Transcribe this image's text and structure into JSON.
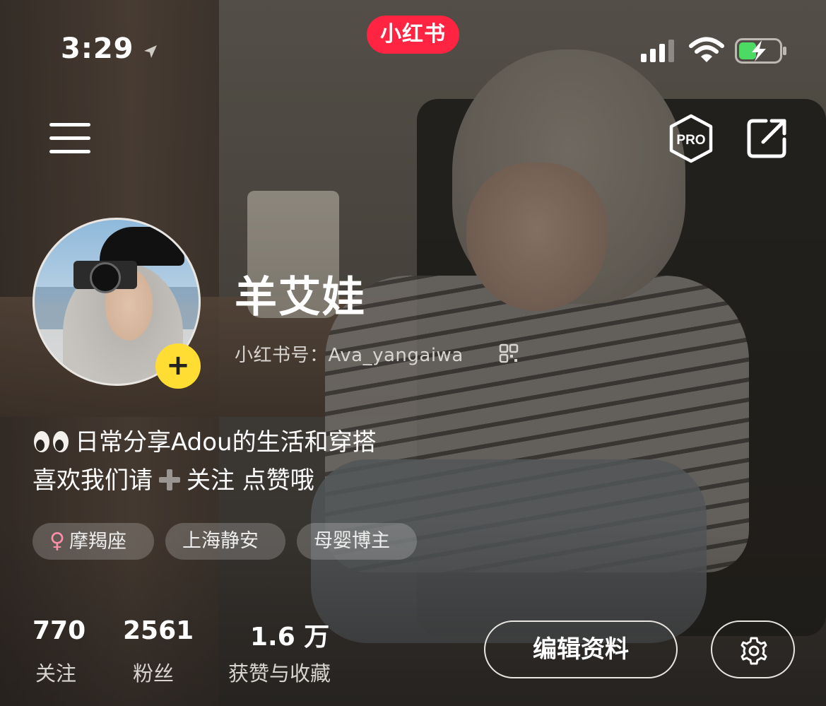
{
  "status_bar": {
    "time": "3:29",
    "brand": "小红书"
  },
  "profile": {
    "name": "羊艾娃",
    "id_label": "小红书号：",
    "id_value": "Ava_yangaiwa",
    "bio_line1": "日常分享Adou的生活和穿搭",
    "bio_line2_a": "喜欢我们请",
    "bio_line2_b": "关注 点赞哦"
  },
  "tags": [
    {
      "icon": "♀",
      "label": "摩羯座"
    },
    {
      "label": "上海静安"
    },
    {
      "label": "母婴博主"
    }
  ],
  "stats": [
    {
      "value": "770",
      "label": "关注"
    },
    {
      "value": "2561",
      "label": "粉丝"
    },
    {
      "value": "1.6 万",
      "label": "获赞与收藏"
    }
  ],
  "actions": {
    "edit_label": "编辑资料",
    "pro_label": "PRO"
  },
  "colors": {
    "brand": "#ff2442",
    "badge": "#ffdd33"
  }
}
